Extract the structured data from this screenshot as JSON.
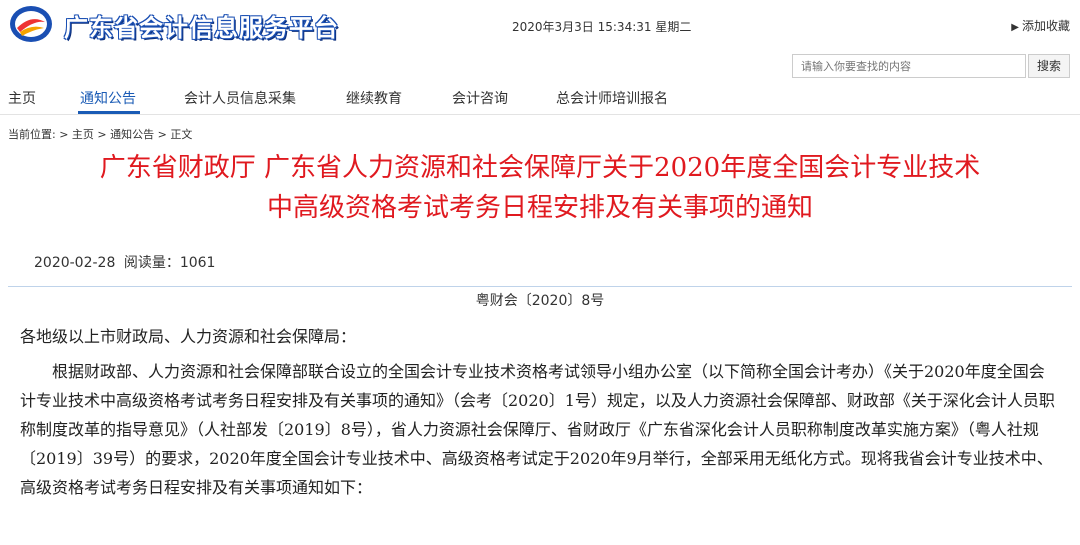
{
  "header": {
    "site_title": "广东省会计信息服务平台",
    "datetime": "2020年3月3日 15:34:31 星期二",
    "favorite_label": "添加收藏"
  },
  "search": {
    "placeholder": "请输入你要查找的内容",
    "button_label": "搜索"
  },
  "nav": {
    "items": [
      {
        "label": "主页"
      },
      {
        "label": "通知公告"
      },
      {
        "label": "会计人员信息采集"
      },
      {
        "label": "继续教育"
      },
      {
        "label": "会计咨询"
      },
      {
        "label": "总会计师培训报名"
      }
    ],
    "active": "通知公告"
  },
  "breadcrumb": "当前位置: > 主页 > 通知公告 > 正文",
  "article": {
    "title_line1": "广东省财政厅 广东省人力资源和社会保障厅关于2020年度全国会计专业技术",
    "title_line2": "中高级资格考试考务日程安排及有关事项的通知",
    "date": "2020-02-28",
    "read_label": "阅读量：1061",
    "doc_number": "粤财会〔2020〕8号",
    "salutation": "各地级以上市财政局、人力资源和社会保障局：",
    "paragraph1": "根据财政部、人力资源和社会保障部联合设立的全国会计专业技术资格考试领导小组办公室（以下简称全国会计考办）《关于2020年度全国会计专业技术中高级资格考试考务日程安排及有关事项的通知》（会考〔2020〕1号）规定，以及人力资源社会保障部、财政部《关于深化会计人员职称制度改革的指导意见》（人社部发〔2019〕8号），省人力资源社会保障厅、省财政厅《广东省深化会计人员职称制度改革实施方案》（粤人社规〔2019〕39号）的要求，2020年度全国会计专业技术中、高级资格考试定于2020年9月举行，全部采用无纸化方式。现将我省会计专业技术中、高级资格考试考务日程安排及有关事项通知如下："
  },
  "colors": {
    "title_red": "#e0191f",
    "nav_blue": "#1a5bb5"
  }
}
